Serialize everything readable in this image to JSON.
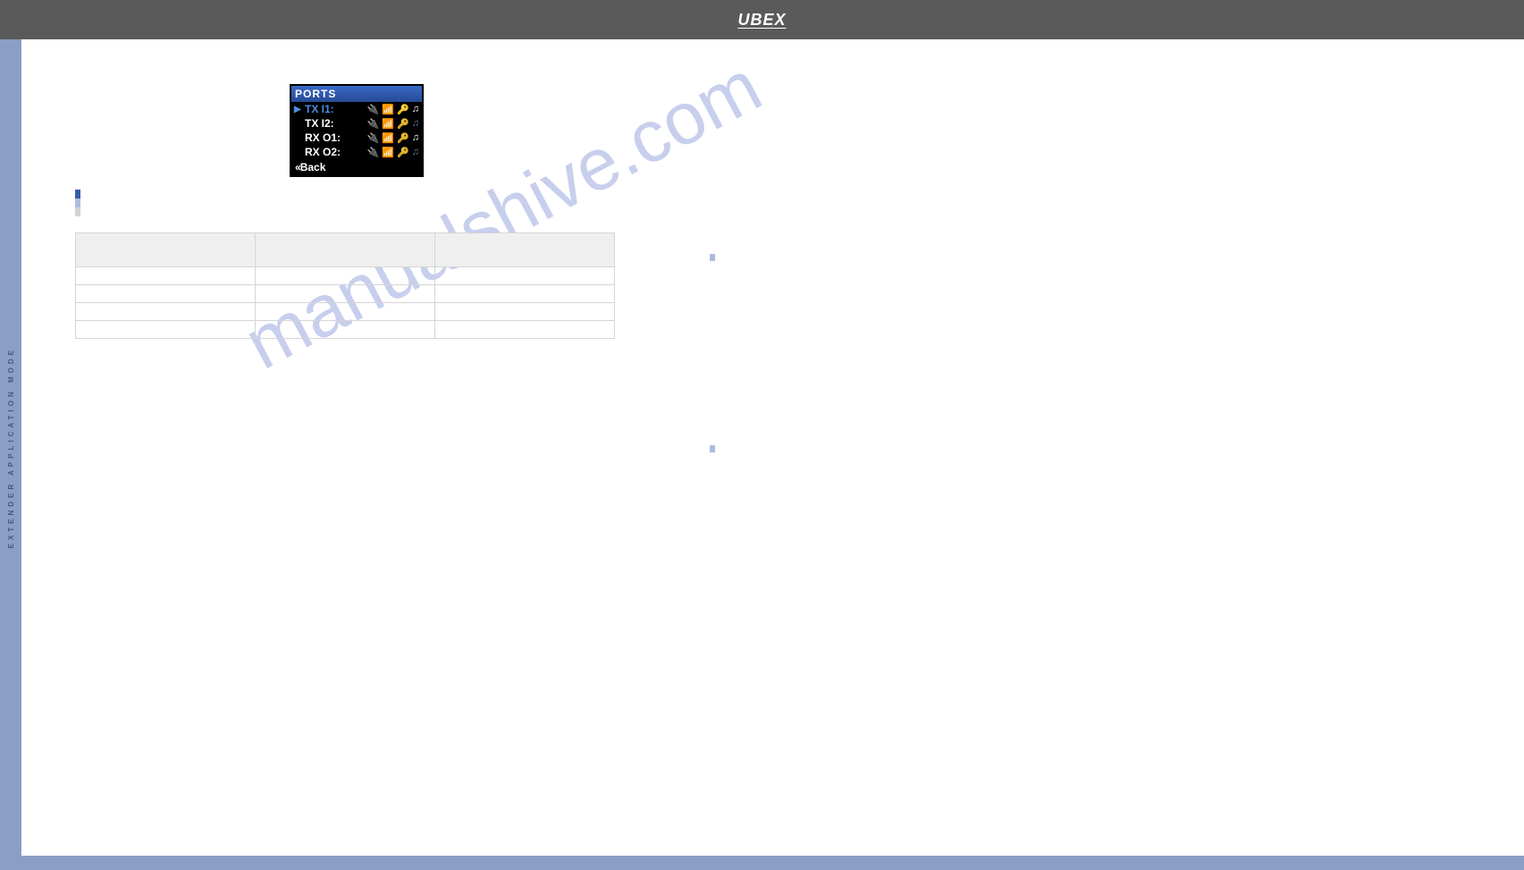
{
  "header": {
    "logo": "UBEX"
  },
  "rail": {
    "text": "EXTENDER APPLICATION MODE"
  },
  "watermark": "manualshive.com",
  "ports_box": {
    "title": "PORTS",
    "rows": [
      {
        "label": "TX I1:",
        "selected": true,
        "key_dim": false,
        "note_dim": false
      },
      {
        "label": "TX I2:",
        "selected": false,
        "key_dim": true,
        "note_dim": true
      },
      {
        "label": "RX O1:",
        "selected": false,
        "key_dim": true,
        "note_dim": false
      },
      {
        "label": "RX O2:",
        "selected": false,
        "key_dim": true,
        "note_dim": true
      }
    ],
    "back": "«Back"
  },
  "table": {
    "headers": [
      "",
      "",
      ""
    ],
    "rows": [
      [
        "",
        "",
        ""
      ],
      [
        "",
        "",
        ""
      ],
      [
        "",
        "",
        ""
      ],
      [
        "",
        "",
        ""
      ]
    ]
  }
}
